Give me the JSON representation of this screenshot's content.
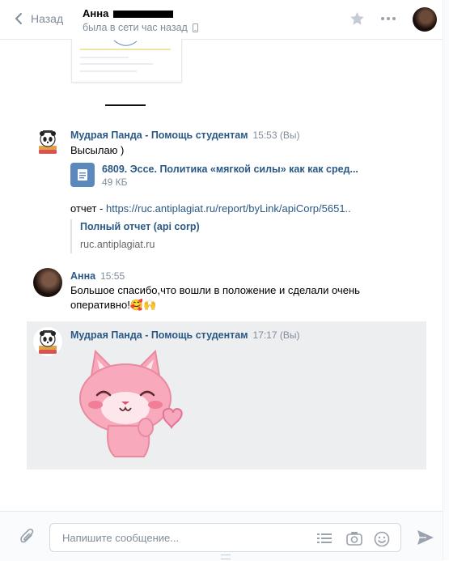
{
  "header": {
    "back_label": "Назад",
    "peer_name": "Анна",
    "peer_status": "была в сети час назад"
  },
  "messages": [
    {
      "author": "Мудрая Панда - Помощь студентам",
      "time": "15:53 (Вы)",
      "text": "Высылаю )",
      "file": {
        "name": "6809. Эссе. Политика «мягкой силы» как как сред...",
        "size": "49 КБ"
      },
      "link_prefix": "отчет - ",
      "link_url": "https://ruc.antiplagiat.ru/report/byLink/apiCorp/5651..",
      "snippet": {
        "title": "Полный отчет (api corp)",
        "domain": "ruc.antiplagiat.ru"
      }
    },
    {
      "author": "Анна",
      "time": "15:55",
      "text_line1": "Большое спасибо,что вошли в положение и сделали очень",
      "text_line2": "оперативно!🥰🙌"
    },
    {
      "author": "Мудрая Панда - Помощь студентам",
      "time": "17:17 (Вы)",
      "sticker": "pink-cat-heart-sticker"
    }
  ],
  "composer": {
    "placeholder": "Напишите сообщение..."
  },
  "colors": {
    "link": "#2a5885",
    "meta": "#818c99",
    "selected_bg": "#edeef0",
    "file_icon": "#5b88bd"
  }
}
